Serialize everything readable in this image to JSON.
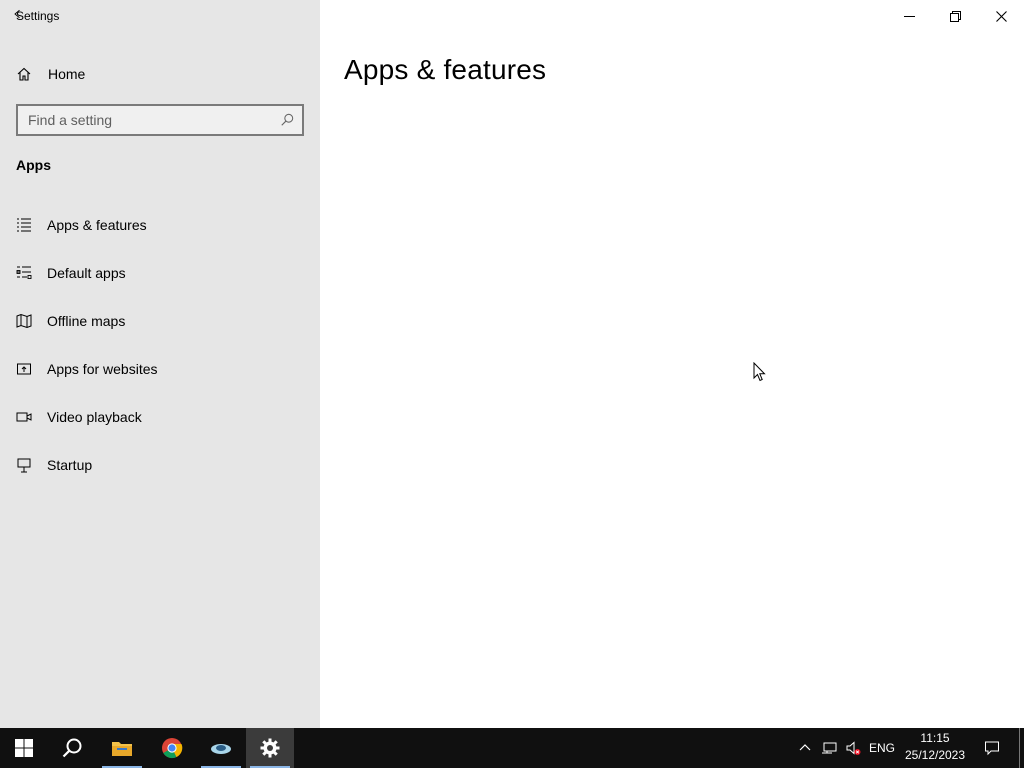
{
  "window": {
    "title": "Settings"
  },
  "sidebar": {
    "home_label": "Home",
    "search_placeholder": "Find a setting",
    "section_title": "Apps",
    "items": [
      {
        "label": "Apps & features",
        "icon": "list-icon"
      },
      {
        "label": "Default apps",
        "icon": "default-apps-icon"
      },
      {
        "label": "Offline maps",
        "icon": "map-icon"
      },
      {
        "label": "Apps for websites",
        "icon": "open-external-icon"
      },
      {
        "label": "Video playback",
        "icon": "video-icon"
      },
      {
        "label": "Startup",
        "icon": "startup-icon"
      }
    ]
  },
  "main": {
    "title": "Apps & features"
  },
  "taskbar": {
    "apps": [
      "start-icon",
      "search-icon",
      "file-explorer-icon",
      "chrome-icon",
      "app-icon",
      "settings-icon"
    ],
    "language": "ENG",
    "time": "11:15",
    "date": "25/12/2023"
  },
  "colors": {
    "sidebar_bg": "#e6e6e6",
    "taskbar_bg": "#101010",
    "accent": "#8bb6e6"
  }
}
